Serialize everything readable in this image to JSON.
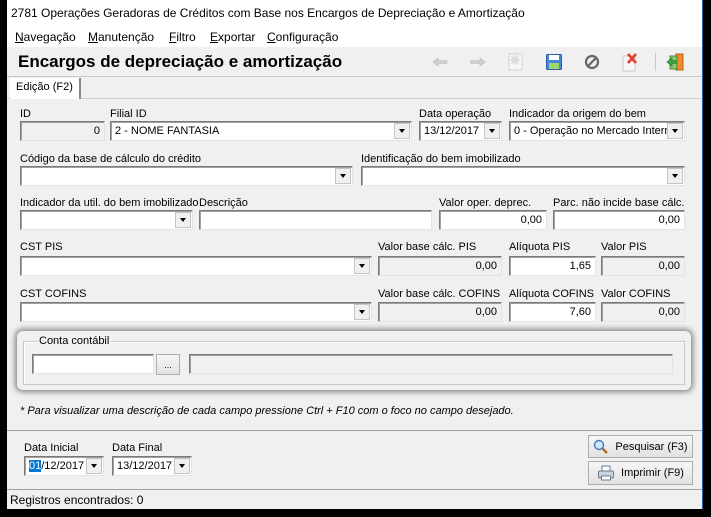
{
  "window": {
    "title": "2781 Operações Geradoras de Créditos com Base nos Encargos de Depreciação e Amortização"
  },
  "menu": [
    {
      "label": "Navegação",
      "accel": "N",
      "rest": "avegação"
    },
    {
      "label": "Manutenção",
      "accel": "M",
      "rest": "anutenção"
    },
    {
      "label": "Filtro",
      "accel": "F",
      "rest": "iltro"
    },
    {
      "label": "Exportar",
      "accel": "E",
      "rest": "xportar"
    },
    {
      "label": "Configuração",
      "accel": "C",
      "rest": "onfiguração"
    }
  ],
  "header": {
    "title": "Encargos de depreciação e amortização",
    "toolbar": [
      {
        "name": "previous-icon",
        "enabled": false
      },
      {
        "name": "next-icon",
        "enabled": false
      },
      {
        "name": "new-record-icon",
        "enabled": false
      },
      {
        "name": "save-icon",
        "enabled": true
      },
      {
        "name": "cancel-icon",
        "enabled": true
      },
      {
        "name": "delete-icon",
        "enabled": true
      },
      {
        "name": "exit-icon",
        "enabled": true
      }
    ]
  },
  "tabs": [
    {
      "label": "Edição (F2)"
    }
  ],
  "form": {
    "id": {
      "label": "ID",
      "value": "0"
    },
    "filial": {
      "label": "Filial ID",
      "value": "2 - NOME FANTASIA"
    },
    "data_operacao": {
      "label": "Data operação",
      "value": "13/12/2017"
    },
    "indicador_origem": {
      "label": "Indicador da origem do bem",
      "value": "0 - Operação no Mercado Intern"
    },
    "codigo_base": {
      "label": "Código da base de cálculo do crédito",
      "value": ""
    },
    "identificacao_bem": {
      "label": "Identificação do bem imobilizado",
      "value": ""
    },
    "indicador_util": {
      "label": "Indicador da util. do bem imobilizado",
      "value": ""
    },
    "descricao": {
      "label": "Descrição",
      "value": ""
    },
    "valor_oper": {
      "label": "Valor oper. deprec.",
      "value": "0,00"
    },
    "parc_nao_incide": {
      "label": "Parc. não incide base cálc.",
      "value": "0,00"
    },
    "cst_pis": {
      "label": "CST PIS",
      "value": ""
    },
    "valor_base_pis": {
      "label": "Valor base cálc. PIS",
      "value": "0,00"
    },
    "aliquota_pis": {
      "label": "Alíquota PIS",
      "value": "1,65"
    },
    "valor_pis": {
      "label": "Valor PIS",
      "value": "0,00"
    },
    "cst_cofins": {
      "label": "CST COFINS",
      "value": ""
    },
    "valor_base_cofins": {
      "label": "Valor base cálc. COFINS",
      "value": "0,00"
    },
    "aliquota_cofins": {
      "label": "Alíquota COFINS",
      "value": "7,60"
    },
    "valor_cofins": {
      "label": "Valor COFINS",
      "value": "0,00"
    },
    "conta_contabil": {
      "legend": "Conta contábil",
      "code": "",
      "lookup_label": "...",
      "description": ""
    }
  },
  "note": "* Para visualizar uma descrição de cada campo pressione Ctrl + F10 com o foco no campo desejado.",
  "filter": {
    "data_inicial": {
      "label": "Data Inicial",
      "value_selected": "01",
      "value_rest": "/12/2017"
    },
    "data_final": {
      "label": "Data Final",
      "value": "13/12/2017"
    },
    "search_button": "Pesquisar (F3)",
    "print_button": "Imprimir (F9)"
  },
  "status": "Registros encontrados: 0"
}
